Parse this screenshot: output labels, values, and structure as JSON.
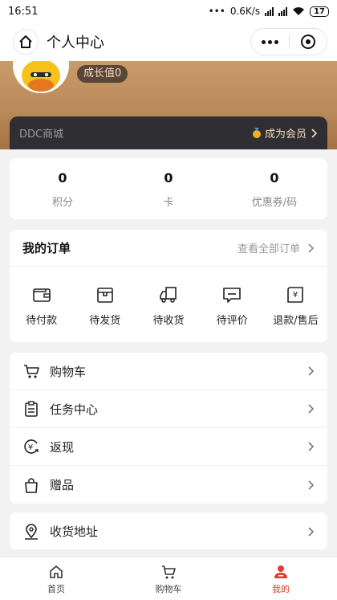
{
  "status": {
    "time": "16:51",
    "speed": "0.6K/s",
    "battery": "17"
  },
  "nav": {
    "title": "个人中心"
  },
  "header": {
    "growth_label": "成长值0",
    "shop_name": "DDC商城",
    "member_label": "成为会员"
  },
  "stats": [
    {
      "value": "0",
      "label": "积分"
    },
    {
      "value": "0",
      "label": "卡"
    },
    {
      "value": "0",
      "label": "优惠券/码"
    }
  ],
  "orders": {
    "title": "我的订单",
    "view_all": "查看全部订单",
    "items": [
      {
        "label": "待付款",
        "icon": "wallet-icon"
      },
      {
        "label": "待发货",
        "icon": "package-icon"
      },
      {
        "label": "待收货",
        "icon": "truck-icon"
      },
      {
        "label": "待评价",
        "icon": "comment-icon"
      },
      {
        "label": "退款/售后",
        "icon": "refund-icon"
      }
    ]
  },
  "menu": [
    {
      "label": "购物车",
      "icon": "cart-icon"
    },
    {
      "label": "任务中心",
      "icon": "clipboard-icon"
    },
    {
      "label": "返现",
      "icon": "cashback-icon"
    },
    {
      "label": "赠品",
      "icon": "gift-bag-icon"
    }
  ],
  "address": {
    "label": "收货地址",
    "icon": "location-icon"
  },
  "tabbar": [
    {
      "label": "首页",
      "icon": "home-icon",
      "active": false
    },
    {
      "label": "购物车",
      "icon": "cart-icon",
      "active": false
    },
    {
      "label": "我的",
      "icon": "user-icon",
      "active": true
    }
  ],
  "colors": {
    "accent": "#e23c2d",
    "header_gold": "#c99a6a",
    "vip_bar": "#2f2f33"
  }
}
